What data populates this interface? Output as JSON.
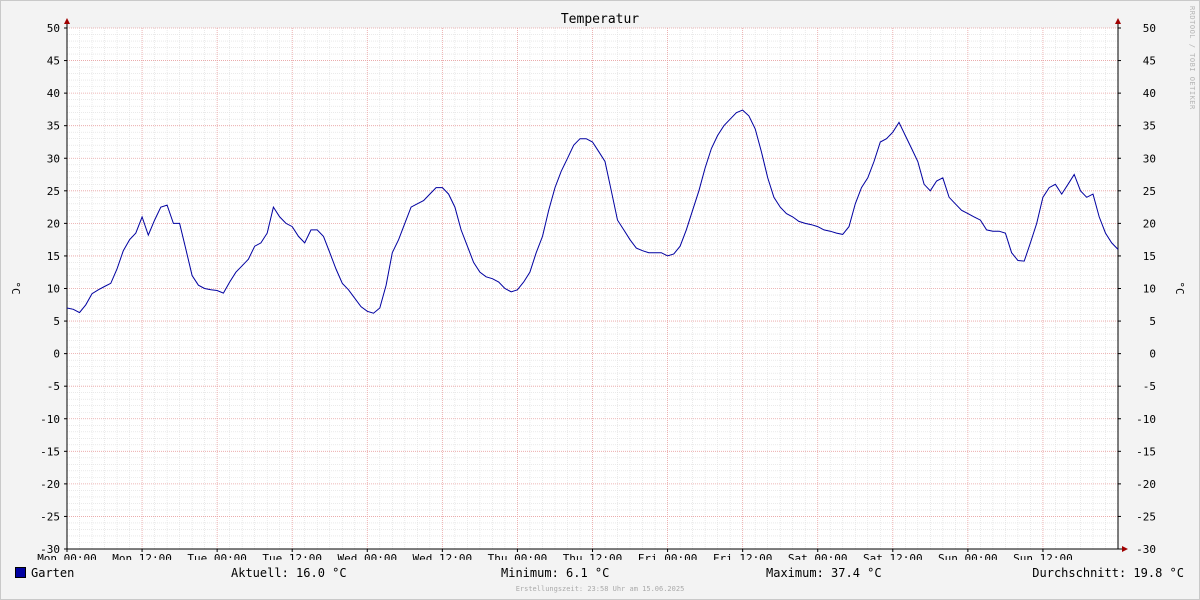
{
  "chart_data": {
    "type": "line",
    "title": "Temperatur",
    "ylabel": "°C",
    "ylabel_right": "°C",
    "ylim": [
      -30,
      50
    ],
    "y_ticks": [
      50,
      45,
      40,
      35,
      30,
      25,
      20,
      15,
      10,
      5,
      0,
      -5,
      -10,
      -15,
      -20,
      -25,
      -30
    ],
    "xlim_hours": [
      0,
      168
    ],
    "x_ticks": [
      {
        "hour": 0,
        "label": "Mon 00:00"
      },
      {
        "hour": 12,
        "label": "Mon 12:00"
      },
      {
        "hour": 24,
        "label": "Tue 00:00"
      },
      {
        "hour": 36,
        "label": "Tue 12:00"
      },
      {
        "hour": 48,
        "label": "Wed 00:00"
      },
      {
        "hour": 60,
        "label": "Wed 12:00"
      },
      {
        "hour": 72,
        "label": "Thu 00:00"
      },
      {
        "hour": 84,
        "label": "Thu 12:00"
      },
      {
        "hour": 96,
        "label": "Fri 00:00"
      },
      {
        "hour": 108,
        "label": "Fri 12:00"
      },
      {
        "hour": 120,
        "label": "Sat 00:00"
      },
      {
        "hour": 132,
        "label": "Sat 12:00"
      },
      {
        "hour": 144,
        "label": "Sun 00:00"
      },
      {
        "hour": 156,
        "label": "Sun 12:00"
      }
    ],
    "grid": true,
    "legend_position": "bottom",
    "line_color": "#0000a0",
    "series": [
      {
        "name": "Garten",
        "points": [
          [
            0,
            7.0
          ],
          [
            1,
            6.8
          ],
          [
            2,
            6.3
          ],
          [
            3,
            7.5
          ],
          [
            4,
            9.2
          ],
          [
            5,
            9.8
          ],
          [
            6,
            10.3
          ],
          [
            7,
            10.8
          ],
          [
            8,
            13.0
          ],
          [
            9,
            15.8
          ],
          [
            10,
            17.5
          ],
          [
            11,
            18.5
          ],
          [
            12,
            21.0
          ],
          [
            13,
            18.2
          ],
          [
            14,
            20.5
          ],
          [
            15,
            22.5
          ],
          [
            16,
            22.8
          ],
          [
            17,
            20.0
          ],
          [
            18,
            20.0
          ],
          [
            19,
            16.0
          ],
          [
            20,
            12.0
          ],
          [
            21,
            10.5
          ],
          [
            22,
            10.0
          ],
          [
            23,
            9.8
          ],
          [
            24,
            9.7
          ],
          [
            25,
            9.3
          ],
          [
            26,
            11.0
          ],
          [
            27,
            12.5
          ],
          [
            28,
            13.5
          ],
          [
            29,
            14.5
          ],
          [
            30,
            16.5
          ],
          [
            31,
            17.0
          ],
          [
            32,
            18.5
          ],
          [
            33,
            22.5
          ],
          [
            34,
            21.0
          ],
          [
            35,
            20.0
          ],
          [
            36,
            19.5
          ],
          [
            37,
            18.0
          ],
          [
            38,
            17.0
          ],
          [
            39,
            19.0
          ],
          [
            40,
            19.0
          ],
          [
            41,
            18.0
          ],
          [
            42,
            15.5
          ],
          [
            43,
            13.0
          ],
          [
            44,
            10.8
          ],
          [
            45,
            9.8
          ],
          [
            46,
            8.5
          ],
          [
            47,
            7.2
          ],
          [
            48,
            6.5
          ],
          [
            49,
            6.2
          ],
          [
            50,
            7.0
          ],
          [
            51,
            10.5
          ],
          [
            52,
            15.5
          ],
          [
            53,
            17.5
          ],
          [
            54,
            20.0
          ],
          [
            55,
            22.5
          ],
          [
            56,
            23.0
          ],
          [
            57,
            23.5
          ],
          [
            58,
            24.5
          ],
          [
            59,
            25.5
          ],
          [
            60,
            25.5
          ],
          [
            61,
            24.5
          ],
          [
            62,
            22.5
          ],
          [
            63,
            19.0
          ],
          [
            64,
            16.5
          ],
          [
            65,
            14.0
          ],
          [
            66,
            12.5
          ],
          [
            67,
            11.8
          ],
          [
            68,
            11.5
          ],
          [
            69,
            11.0
          ],
          [
            70,
            10.0
          ],
          [
            71,
            9.5
          ],
          [
            72,
            9.8
          ],
          [
            73,
            11.0
          ],
          [
            74,
            12.5
          ],
          [
            75,
            15.5
          ],
          [
            76,
            18.0
          ],
          [
            77,
            22.0
          ],
          [
            78,
            25.5
          ],
          [
            79,
            28.0
          ],
          [
            80,
            30.0
          ],
          [
            81,
            32.0
          ],
          [
            82,
            33.0
          ],
          [
            83,
            33.0
          ],
          [
            84,
            32.5
          ],
          [
            85,
            31.0
          ],
          [
            86,
            29.5
          ],
          [
            87,
            25.0
          ],
          [
            88,
            20.5
          ],
          [
            89,
            19.0
          ],
          [
            90,
            17.5
          ],
          [
            91,
            16.2
          ],
          [
            92,
            15.8
          ],
          [
            93,
            15.5
          ],
          [
            94,
            15.5
          ],
          [
            95,
            15.5
          ],
          [
            96,
            15.0
          ],
          [
            97,
            15.3
          ],
          [
            98,
            16.5
          ],
          [
            99,
            19.0
          ],
          [
            100,
            22.0
          ],
          [
            101,
            25.0
          ],
          [
            102,
            28.5
          ],
          [
            103,
            31.5
          ],
          [
            104,
            33.5
          ],
          [
            105,
            35.0
          ],
          [
            106,
            36.0
          ],
          [
            107,
            37.0
          ],
          [
            108,
            37.4
          ],
          [
            109,
            36.5
          ],
          [
            110,
            34.5
          ],
          [
            111,
            31.0
          ],
          [
            112,
            27.0
          ],
          [
            113,
            24.0
          ],
          [
            114,
            22.5
          ],
          [
            115,
            21.5
          ],
          [
            116,
            21.0
          ],
          [
            117,
            20.3
          ],
          [
            118,
            20.0
          ],
          [
            119,
            19.8
          ],
          [
            120,
            19.5
          ],
          [
            121,
            19.0
          ],
          [
            122,
            18.8
          ],
          [
            123,
            18.5
          ],
          [
            124,
            18.3
          ],
          [
            125,
            19.5
          ],
          [
            126,
            23.0
          ],
          [
            127,
            25.5
          ],
          [
            128,
            27.0
          ],
          [
            129,
            29.5
          ],
          [
            130,
            32.5
          ],
          [
            131,
            33.0
          ],
          [
            132,
            34.0
          ],
          [
            133,
            35.5
          ],
          [
            134,
            33.5
          ],
          [
            135,
            31.5
          ],
          [
            136,
            29.5
          ],
          [
            137,
            26.0
          ],
          [
            138,
            25.0
          ],
          [
            139,
            26.5
          ],
          [
            140,
            27.0
          ],
          [
            141,
            24.0
          ],
          [
            142,
            23.0
          ],
          [
            143,
            22.0
          ],
          [
            144,
            21.5
          ],
          [
            145,
            21.0
          ],
          [
            146,
            20.5
          ],
          [
            147,
            19.0
          ],
          [
            148,
            18.8
          ],
          [
            149,
            18.8
          ],
          [
            150,
            18.5
          ],
          [
            151,
            15.5
          ],
          [
            152,
            14.3
          ],
          [
            153,
            14.2
          ],
          [
            154,
            17.0
          ],
          [
            155,
            20.0
          ],
          [
            156,
            24.0
          ],
          [
            157,
            25.5
          ],
          [
            158,
            26.0
          ],
          [
            159,
            24.5
          ],
          [
            160,
            26.0
          ],
          [
            161,
            27.5
          ],
          [
            162,
            25.0
          ],
          [
            163,
            24.0
          ],
          [
            164,
            24.5
          ],
          [
            165,
            21.0
          ],
          [
            166,
            18.5
          ],
          [
            167,
            17.0
          ],
          [
            168,
            16.0
          ]
        ]
      }
    ]
  },
  "legend": {
    "series_name": "Garten",
    "current": "Aktuell: 16.0 °C",
    "minimum": "Minimum: 6.1 °C",
    "maximum": "Maximum: 37.4 °C",
    "average": "Durchschnitt: 19.8 °C"
  },
  "footer": "Erstellungszeit: 23:58 Uhr am 15.06.2025",
  "watermark": "RRDTOOL / TOBI OETIKER"
}
